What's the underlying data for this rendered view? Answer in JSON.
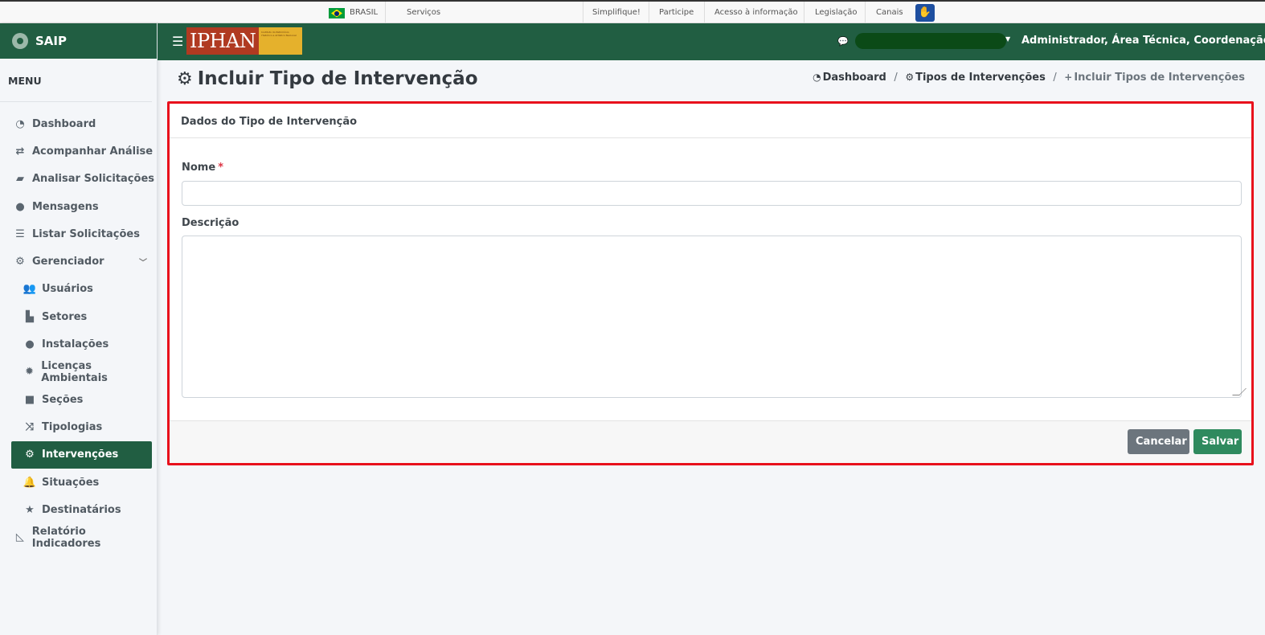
{
  "govbar": {
    "country": "BRASIL",
    "links": [
      "Serviços",
      "Simplifique!",
      "Participe",
      "Acesso à informação",
      "Legislação",
      "Canais"
    ]
  },
  "brand": {
    "name": "SAIP"
  },
  "menu": {
    "title": "MENU",
    "items": [
      {
        "label": "Dashboard",
        "icon": "dashboard-icon"
      },
      {
        "label": "Acompanhar Análise",
        "icon": "exchange-icon"
      },
      {
        "label": "Analisar Solicitações",
        "icon": "book-icon"
      },
      {
        "label": "Mensagens",
        "icon": "comments-icon"
      },
      {
        "label": "Listar Solicitações",
        "icon": "list-icon"
      },
      {
        "label": "Gerenciador",
        "icon": "gears-icon"
      },
      {
        "label": "Usuários",
        "icon": "users-icon"
      },
      {
        "label": "Setores",
        "icon": "industry-icon"
      },
      {
        "label": "Instalações",
        "icon": "circle-icon"
      },
      {
        "label": "Licenças Ambientais",
        "icon": "certificate-icon"
      },
      {
        "label": "Seções",
        "icon": "square-icon"
      },
      {
        "label": "Tipologias",
        "icon": "random-icon"
      },
      {
        "label": "Intervenções",
        "icon": "gear-icon"
      },
      {
        "label": "Situações",
        "icon": "bell-icon"
      },
      {
        "label": "Destinatários",
        "icon": "star-icon"
      },
      {
        "label": "Relatório Indicadores",
        "icon": "area-chart-icon"
      }
    ]
  },
  "header": {
    "logo_word": "IPHAN",
    "logo_tagline": "Instituto do Patrimônio Histórico e Artístico Nacional",
    "user": "Administrador, Área Técnica, Coordenação..."
  },
  "page": {
    "title": "Incluir Tipo de Intervenção",
    "breadcrumb": [
      "Dashboard",
      "Tipos de Intervenções",
      "Incluir Tipos de Intervenções"
    ]
  },
  "form": {
    "card_title": "Dados do Tipo de Intervenção",
    "nome_label": "Nome",
    "required_mark": "*",
    "nome_value": "",
    "descricao_label": "Descrição",
    "descricao_value": "",
    "cancel_label": "Cancelar",
    "save_label": "Salvar"
  },
  "colors": {
    "primary_green": "#215e42",
    "highlight_border": "#e8101c",
    "save_button": "#2f8a5e",
    "cancel_button": "#6c757d"
  }
}
